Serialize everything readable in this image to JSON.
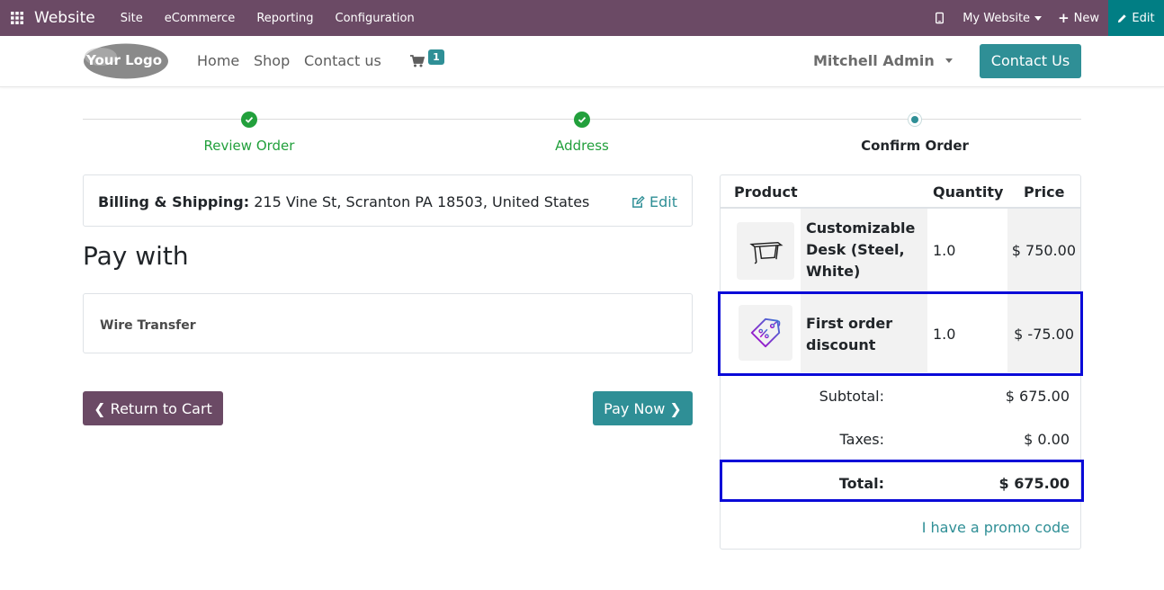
{
  "topbar": {
    "app_name": "Website",
    "menu": [
      "Site",
      "eCommerce",
      "Reporting",
      "Configuration"
    ],
    "site_selector": "My Website",
    "new_label": "New",
    "edit_label": "Edit",
    "bar_color": "#6b4a65",
    "edit_color": "#017e84"
  },
  "header": {
    "logo_text": "Your Logo",
    "nav": [
      "Home",
      "Shop",
      "Contact us"
    ],
    "cart_count": "1",
    "user_name": "Mitchell Admin",
    "contact_button": "Contact Us",
    "accent_color": "#2f8f96"
  },
  "wizard": {
    "steps": [
      {
        "label": "Review Order",
        "state": "done"
      },
      {
        "label": "Address",
        "state": "done"
      },
      {
        "label": "Confirm Order",
        "state": "current"
      }
    ]
  },
  "billing": {
    "label": "Billing & Shipping:",
    "address": "215 Vine St, Scranton PA 18503, United States",
    "edit_label": "Edit"
  },
  "payment": {
    "heading": "Pay with",
    "method": "Wire Transfer",
    "return_label": "Return to Cart",
    "pay_label": "Pay Now"
  },
  "order": {
    "headers": {
      "product": "Product",
      "quantity": "Quantity",
      "price": "Price"
    },
    "lines": [
      {
        "product_line1": "Customizable",
        "product_line2": "Desk (Steel,",
        "product_line3": "White)",
        "quantity": "1.0",
        "price": "$ 750.00",
        "icon": "desk-image"
      },
      {
        "product_line1": "First order",
        "product_line2": "discount",
        "quantity": "1.0",
        "price": "$ -75.00",
        "icon": "discount-tag-icon"
      }
    ],
    "subtotal_label": "Subtotal:",
    "subtotal": "$ 675.00",
    "taxes_label": "Taxes:",
    "taxes": "$ 0.00",
    "total_label": "Total:",
    "total": "$ 675.00",
    "promo_label": "I have a promo code",
    "highlight_color": "#0a0ad8"
  }
}
